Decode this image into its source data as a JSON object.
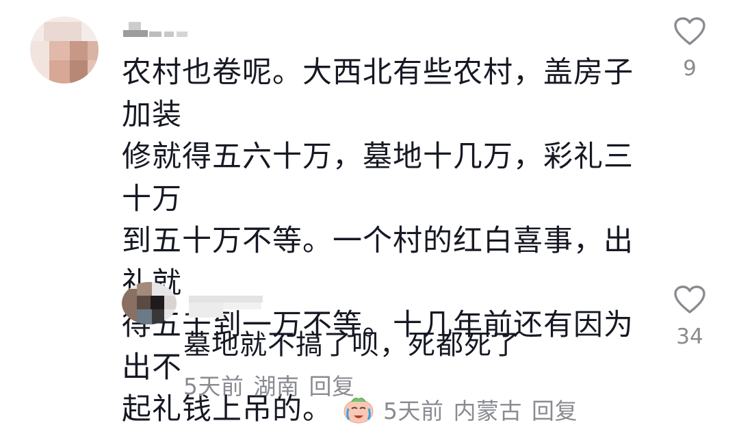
{
  "comments": [
    {
      "text_lines": [
        "农村也卷呢。大西北有些农村，盖房子加装",
        "修就得五六十万，墓地十几万，彩礼三十万",
        "到五十万不等。一个村的红白喜事，出礼就",
        "得五千到一万不等。十几年前还有因为出不",
        "起礼钱上吊的。"
      ],
      "emoji": "crying-face-emoji",
      "time": "5天前",
      "location": "内蒙古",
      "reply_label": "回复",
      "likes": "9"
    },
    {
      "text": "墓地就不搞了呗，死都死了",
      "time": "5天前",
      "location": "湖南",
      "reply_label": "回复",
      "likes": "34"
    }
  ],
  "colors": {
    "text": "#161823",
    "meta": "#8a8b91",
    "heart": "#8a8b91"
  }
}
